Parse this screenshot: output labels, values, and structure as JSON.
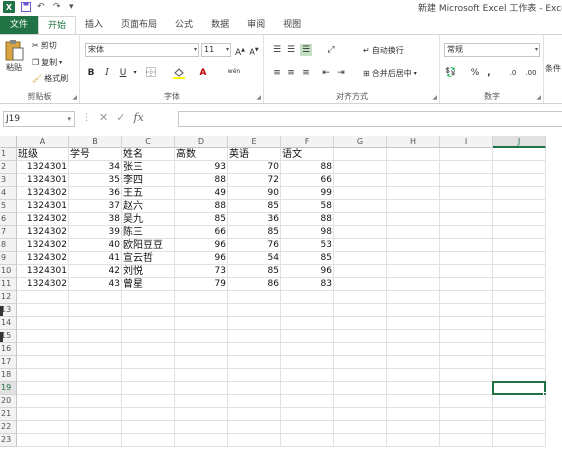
{
  "window": {
    "title": "新建 Microsoft Excel 工作表 - Exce",
    "logo": "X"
  },
  "qat": {
    "save_icon": "save-icon",
    "undo_icon": "undo-icon",
    "redo_icon": "redo-icon",
    "customize_icon": "customize-qat-icon"
  },
  "tabs": [
    {
      "label": "文件"
    },
    {
      "label": "开始"
    },
    {
      "label": "插入"
    },
    {
      "label": "页面布局"
    },
    {
      "label": "公式"
    },
    {
      "label": "数据"
    },
    {
      "label": "审阅"
    },
    {
      "label": "视图"
    }
  ],
  "ribbon": {
    "clipboard": {
      "paste": "粘贴",
      "cut": "剪切",
      "copy": "复制",
      "format_painter": "格式刷",
      "label": "剪贴板"
    },
    "font": {
      "font_name": "宋体",
      "font_size": "11",
      "grow": "A",
      "shrink": "A",
      "bold": "B",
      "italic": "I",
      "underline": "U",
      "phonetic": "wén",
      "label": "字体"
    },
    "alignment": {
      "wrap": "自动换行",
      "merge": "合并后居中",
      "label": "对齐方式"
    },
    "number": {
      "format": "常规",
      "percent": "%",
      "comma": ",",
      "label": "数字"
    },
    "styles": {
      "conditional": "条件"
    }
  },
  "formula_bar": {
    "name_box": "J19",
    "fx": "fx",
    "value": ""
  },
  "grid": {
    "columns": [
      "A",
      "B",
      "C",
      "D",
      "E",
      "F",
      "G",
      "H",
      "I",
      "J"
    ],
    "row_numbers": [
      "1",
      "2",
      "3",
      "4",
      "5",
      "6",
      "7",
      "8",
      "9",
      "10",
      "11",
      "12",
      "13",
      "14",
      "15",
      "16",
      "17",
      "18",
      "19",
      "20",
      "21",
      "22",
      "23"
    ],
    "header_row": [
      "班级",
      "学号",
      "姓名",
      "高数",
      "英语",
      "语文"
    ],
    "rows": [
      [
        "1324301",
        "34",
        "张三",
        "93",
        "70",
        "88"
      ],
      [
        "1324301",
        "35",
        "李四",
        "88",
        "72",
        "66"
      ],
      [
        "1324302",
        "36",
        "王五",
        "49",
        "90",
        "99"
      ],
      [
        "1324301",
        "37",
        "赵六",
        "88",
        "85",
        "58"
      ],
      [
        "1324302",
        "38",
        "吴九",
        "85",
        "36",
        "88"
      ],
      [
        "1324302",
        "39",
        "陈三",
        "66",
        "85",
        "98"
      ],
      [
        "1324302",
        "40",
        "欧阳豆豆",
        "96",
        "76",
        "53"
      ],
      [
        "1324302",
        "41",
        "宣云哲",
        "96",
        "54",
        "85"
      ],
      [
        "1324301",
        "42",
        "刘悦",
        "73",
        "85",
        "96"
      ],
      [
        "1324302",
        "43",
        "曾星",
        "79",
        "86",
        "83"
      ]
    ],
    "selected_cell": "J19"
  },
  "colors": {
    "accent": "#217346"
  }
}
